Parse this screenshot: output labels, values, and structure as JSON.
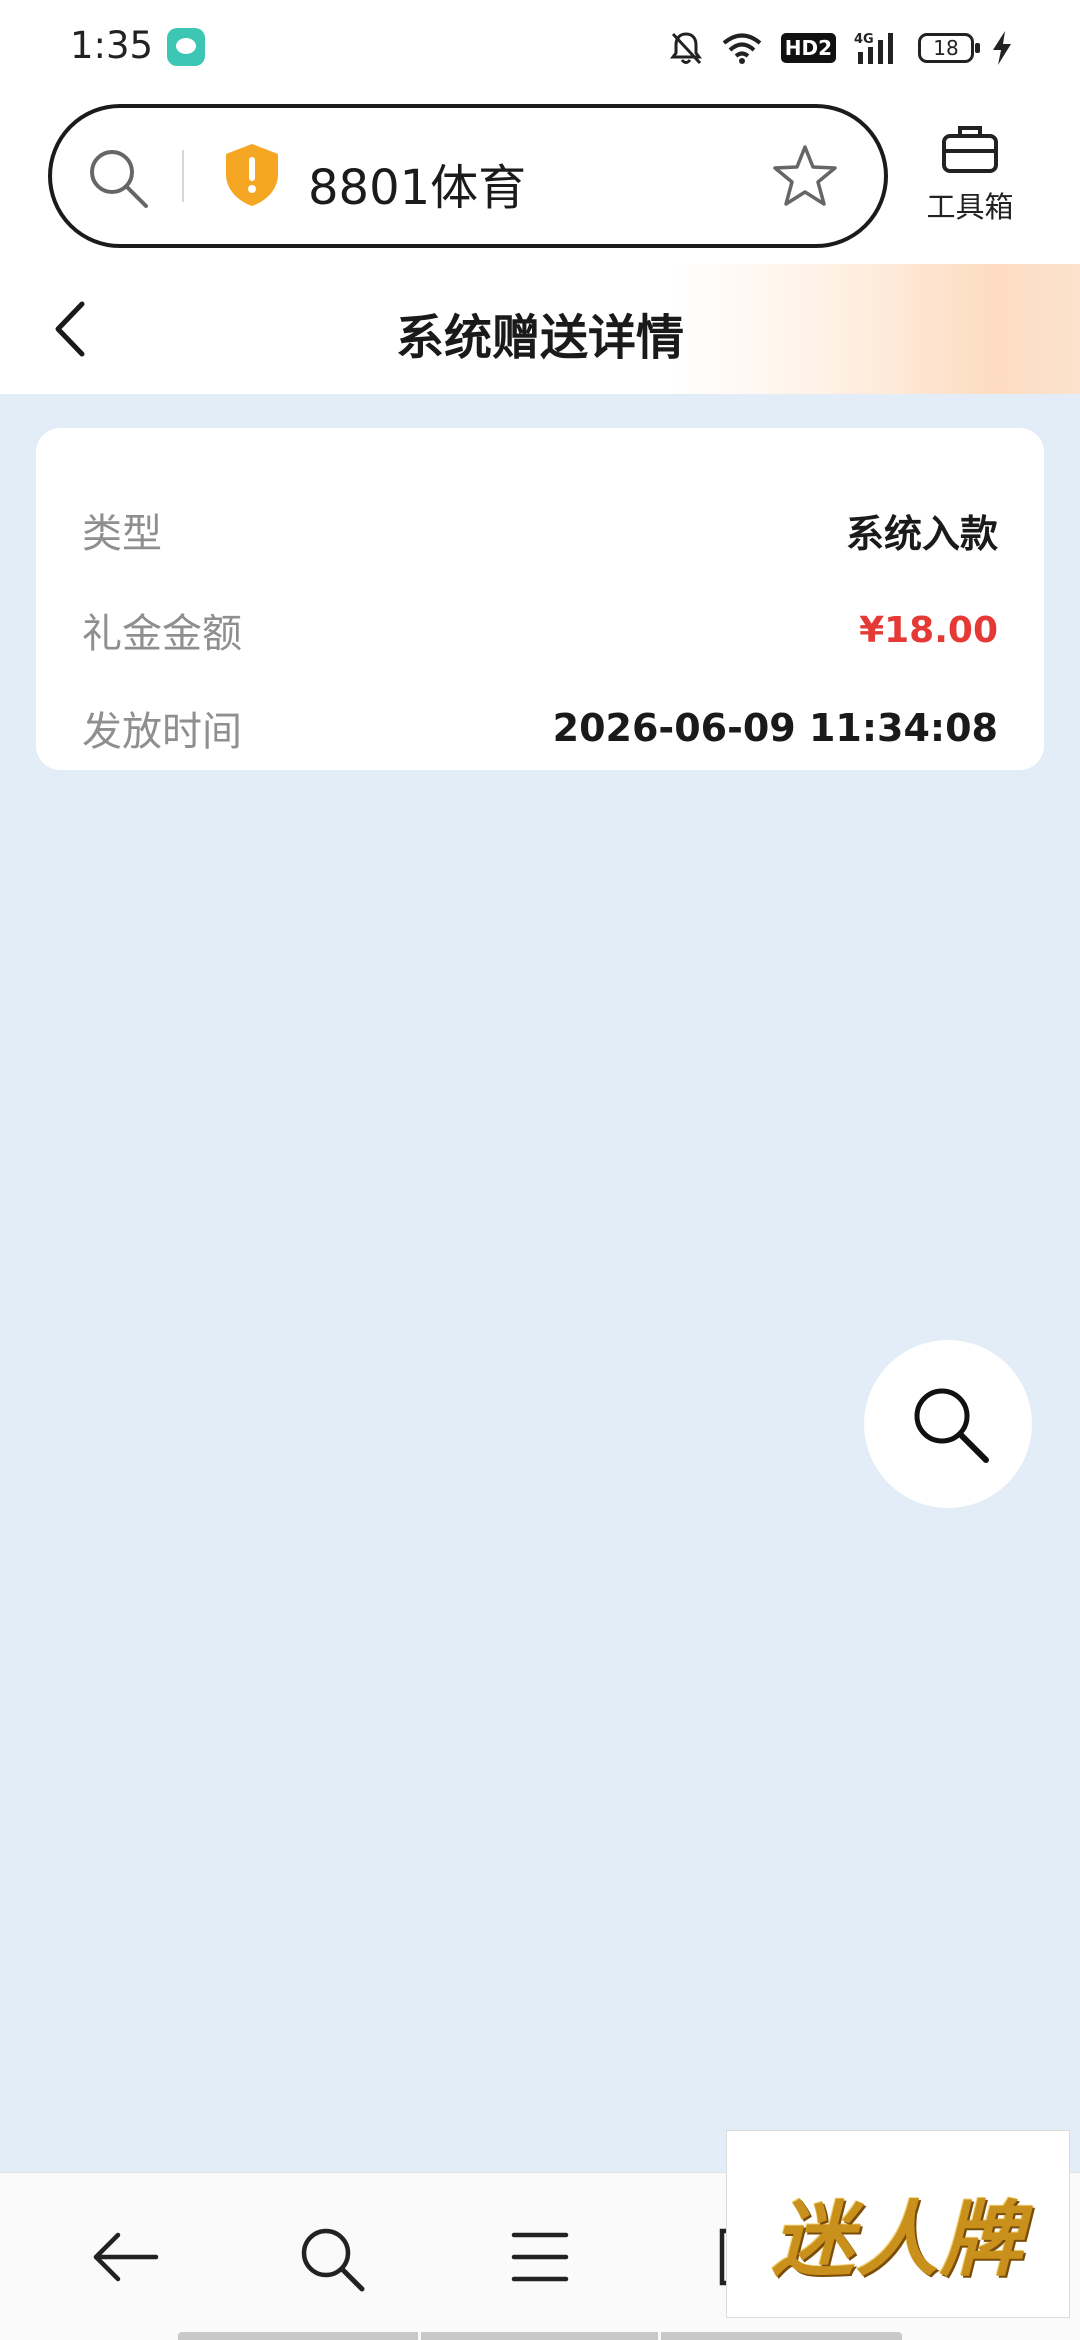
{
  "status_bar": {
    "time": "1:35",
    "network": "4G",
    "hd_label": "HD2",
    "battery": "18"
  },
  "browser": {
    "address_text": "8801体育",
    "toolbox_label": "工具箱"
  },
  "page": {
    "title": "系统赠送详情"
  },
  "detail": {
    "rows": [
      {
        "label": "类型",
        "value": "系统入款"
      },
      {
        "label": "礼金金额",
        "value": "¥18.00"
      },
      {
        "label": "发放时间",
        "value": "2026-06-09 11:34:08"
      }
    ]
  },
  "watermark": {
    "text": "迷人牌"
  },
  "colors": {
    "background": "#e2edf7",
    "amount": "#e53935",
    "shield": "#f5a623"
  }
}
